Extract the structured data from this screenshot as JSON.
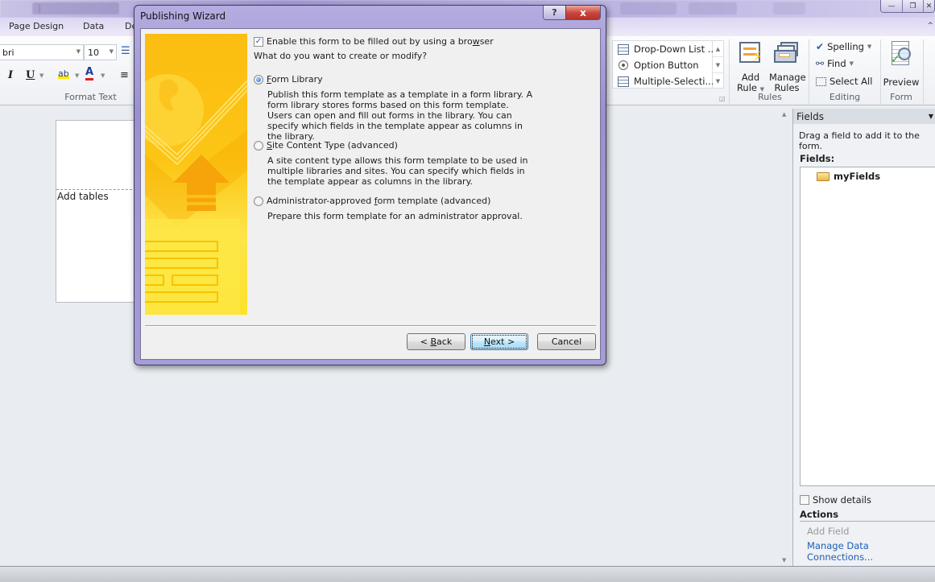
{
  "app": {
    "window_controls": {
      "minimize": "—",
      "restore": "❐",
      "close": "✕"
    },
    "ribbon_collapse_icon": "^"
  },
  "tabs": [
    {
      "label": "Page Design"
    },
    {
      "label": "Data"
    },
    {
      "label": "De"
    }
  ],
  "ribbon": {
    "font_name": "bri",
    "font_size": "10",
    "format_text_label": "Format Text",
    "italic": "I",
    "underline": "U",
    "highlight": "ab",
    "font_color": "A",
    "controls_gallery": [
      {
        "label": "Drop-Down List ...",
        "icon": "dropdown-list-icon"
      },
      {
        "label": "Option Button",
        "icon": "option-button-icon"
      },
      {
        "label": "Multiple-Selecti...",
        "icon": "multiple-selection-icon"
      }
    ],
    "rules": {
      "add_rule": "Add Rule",
      "add_rule_line1": "Add",
      "add_rule_line2": "Rule",
      "manage_rules_line1": "Manage",
      "manage_rules_line2": "Rules",
      "group_label": "Rules"
    },
    "editing": {
      "spelling": "Spelling",
      "find": "Find",
      "select_all": "Select All",
      "group_label": "Editing"
    },
    "form": {
      "preview": "Preview",
      "group_label": "Form"
    }
  },
  "canvas": {
    "placeholder_text": "Add tables"
  },
  "task_pane": {
    "title": "Fields",
    "hint": "Drag a field to add it to the form.",
    "fields_label": "Fields:",
    "tree": [
      {
        "label": "myFields",
        "icon": "folder-icon"
      }
    ],
    "show_details": {
      "label": "Show details",
      "checked": false
    },
    "actions_label": "Actions",
    "add_field": "Add Field",
    "manage_connections": "Manage Data Connections..."
  },
  "dialog": {
    "title": "Publishing Wizard",
    "help": "?",
    "close": "x",
    "enable_browser": {
      "checked": true,
      "label_pre": "Enable this form to be filled out by using a bro",
      "label_ul": "w",
      "label_post": "ser"
    },
    "question": "What do you want to create or modify?",
    "options": [
      {
        "selected": true,
        "label_ul": "F",
        "label_rest": "orm Library",
        "description": "Publish this form template as a template in a form library. A form library stores forms based on this form template. Users can open and fill out forms in the library. You can specify which fields in the template appear as columns in the library."
      },
      {
        "selected": false,
        "label_ul": "S",
        "label_rest": "ite Content Type (advanced)",
        "description": "A site content type allows this form template to be used in multiple libraries and sites. You can specify which fields in the template appear as columns in the library."
      },
      {
        "selected": false,
        "label_pre": "Administrator-approved ",
        "label_ul": "f",
        "label_rest": "orm template (advanced)",
        "description": "Prepare this form template for an administrator approval."
      }
    ],
    "buttons": {
      "back_pre": "< ",
      "back_ul": "B",
      "back_rest": "ack",
      "next_ul": "N",
      "next_rest": "ext >",
      "cancel": "Cancel"
    }
  }
}
